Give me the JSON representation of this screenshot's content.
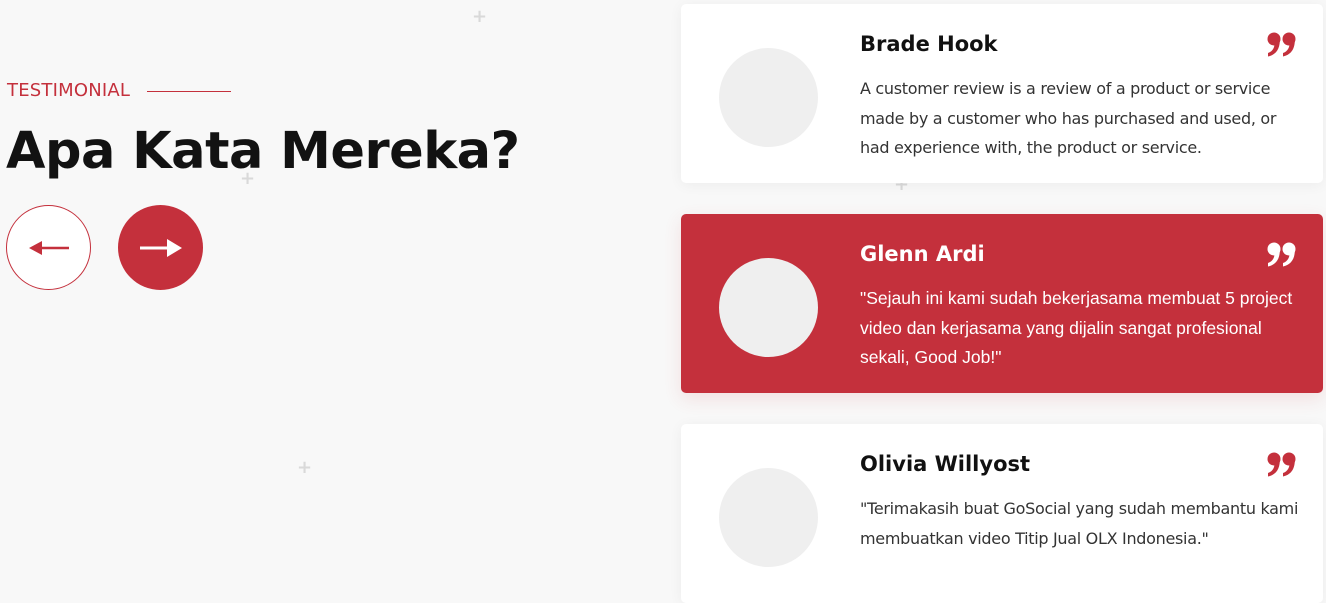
{
  "section": {
    "eyebrow": "TESTIMONIAL",
    "title": "Apa Kata Mereka?"
  },
  "navigation": {
    "prev_icon": "arrow-left-icon",
    "next_icon": "arrow-right-icon"
  },
  "colors": {
    "accent": "#c4303c",
    "background": "#f8f8f8",
    "card": "#ffffff",
    "avatar": "#efefef"
  },
  "testimonials": [
    {
      "name": "Brade Hook",
      "text": "A customer review is a review of a product or service made by a customer who has purchased and used, or had experience with, the product or service.",
      "active": false,
      "icon": "quote-icon"
    },
    {
      "name": "Glenn Ardi",
      "text": "\"Sejauh ini kami sudah bekerjasama membuat 5 project video dan kerjasama yang dijalin sangat profesional sekali, Good Job!\"",
      "active": true,
      "icon": "quote-icon"
    },
    {
      "name": "Olivia Willyost",
      "text": "\"Terimakasih buat GoSocial yang sudah membantu kami membuatkan video Titip Jual OLX Indonesia.\"",
      "active": false,
      "icon": "quote-icon"
    }
  ]
}
